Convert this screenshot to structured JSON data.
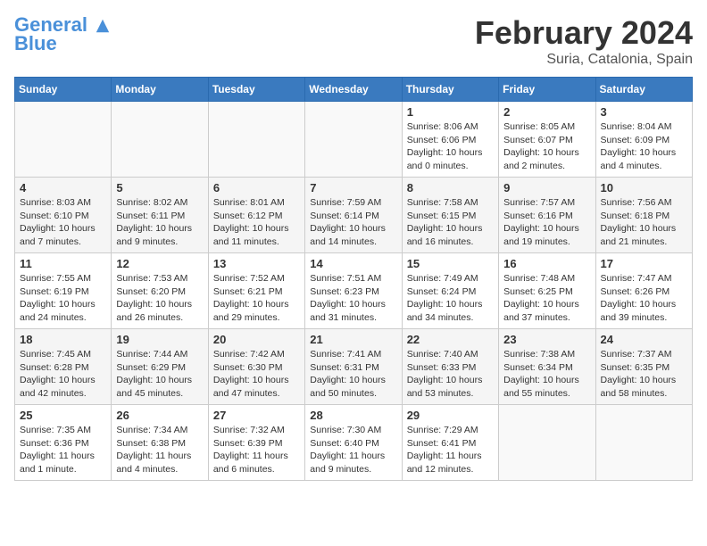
{
  "header": {
    "logo_line1": "General",
    "logo_line2": "Blue",
    "month": "February 2024",
    "location": "Suria, Catalonia, Spain"
  },
  "days_of_week": [
    "Sunday",
    "Monday",
    "Tuesday",
    "Wednesday",
    "Thursday",
    "Friday",
    "Saturday"
  ],
  "weeks": [
    [
      {
        "day": "",
        "info": ""
      },
      {
        "day": "",
        "info": ""
      },
      {
        "day": "",
        "info": ""
      },
      {
        "day": "",
        "info": ""
      },
      {
        "day": "1",
        "info": "Sunrise: 8:06 AM\nSunset: 6:06 PM\nDaylight: 10 hours\nand 0 minutes."
      },
      {
        "day": "2",
        "info": "Sunrise: 8:05 AM\nSunset: 6:07 PM\nDaylight: 10 hours\nand 2 minutes."
      },
      {
        "day": "3",
        "info": "Sunrise: 8:04 AM\nSunset: 6:09 PM\nDaylight: 10 hours\nand 4 minutes."
      }
    ],
    [
      {
        "day": "4",
        "info": "Sunrise: 8:03 AM\nSunset: 6:10 PM\nDaylight: 10 hours\nand 7 minutes."
      },
      {
        "day": "5",
        "info": "Sunrise: 8:02 AM\nSunset: 6:11 PM\nDaylight: 10 hours\nand 9 minutes."
      },
      {
        "day": "6",
        "info": "Sunrise: 8:01 AM\nSunset: 6:12 PM\nDaylight: 10 hours\nand 11 minutes."
      },
      {
        "day": "7",
        "info": "Sunrise: 7:59 AM\nSunset: 6:14 PM\nDaylight: 10 hours\nand 14 minutes."
      },
      {
        "day": "8",
        "info": "Sunrise: 7:58 AM\nSunset: 6:15 PM\nDaylight: 10 hours\nand 16 minutes."
      },
      {
        "day": "9",
        "info": "Sunrise: 7:57 AM\nSunset: 6:16 PM\nDaylight: 10 hours\nand 19 minutes."
      },
      {
        "day": "10",
        "info": "Sunrise: 7:56 AM\nSunset: 6:18 PM\nDaylight: 10 hours\nand 21 minutes."
      }
    ],
    [
      {
        "day": "11",
        "info": "Sunrise: 7:55 AM\nSunset: 6:19 PM\nDaylight: 10 hours\nand 24 minutes."
      },
      {
        "day": "12",
        "info": "Sunrise: 7:53 AM\nSunset: 6:20 PM\nDaylight: 10 hours\nand 26 minutes."
      },
      {
        "day": "13",
        "info": "Sunrise: 7:52 AM\nSunset: 6:21 PM\nDaylight: 10 hours\nand 29 minutes."
      },
      {
        "day": "14",
        "info": "Sunrise: 7:51 AM\nSunset: 6:23 PM\nDaylight: 10 hours\nand 31 minutes."
      },
      {
        "day": "15",
        "info": "Sunrise: 7:49 AM\nSunset: 6:24 PM\nDaylight: 10 hours\nand 34 minutes."
      },
      {
        "day": "16",
        "info": "Sunrise: 7:48 AM\nSunset: 6:25 PM\nDaylight: 10 hours\nand 37 minutes."
      },
      {
        "day": "17",
        "info": "Sunrise: 7:47 AM\nSunset: 6:26 PM\nDaylight: 10 hours\nand 39 minutes."
      }
    ],
    [
      {
        "day": "18",
        "info": "Sunrise: 7:45 AM\nSunset: 6:28 PM\nDaylight: 10 hours\nand 42 minutes."
      },
      {
        "day": "19",
        "info": "Sunrise: 7:44 AM\nSunset: 6:29 PM\nDaylight: 10 hours\nand 45 minutes."
      },
      {
        "day": "20",
        "info": "Sunrise: 7:42 AM\nSunset: 6:30 PM\nDaylight: 10 hours\nand 47 minutes."
      },
      {
        "day": "21",
        "info": "Sunrise: 7:41 AM\nSunset: 6:31 PM\nDaylight: 10 hours\nand 50 minutes."
      },
      {
        "day": "22",
        "info": "Sunrise: 7:40 AM\nSunset: 6:33 PM\nDaylight: 10 hours\nand 53 minutes."
      },
      {
        "day": "23",
        "info": "Sunrise: 7:38 AM\nSunset: 6:34 PM\nDaylight: 10 hours\nand 55 minutes."
      },
      {
        "day": "24",
        "info": "Sunrise: 7:37 AM\nSunset: 6:35 PM\nDaylight: 10 hours\nand 58 minutes."
      }
    ],
    [
      {
        "day": "25",
        "info": "Sunrise: 7:35 AM\nSunset: 6:36 PM\nDaylight: 11 hours\nand 1 minute."
      },
      {
        "day": "26",
        "info": "Sunrise: 7:34 AM\nSunset: 6:38 PM\nDaylight: 11 hours\nand 4 minutes."
      },
      {
        "day": "27",
        "info": "Sunrise: 7:32 AM\nSunset: 6:39 PM\nDaylight: 11 hours\nand 6 minutes."
      },
      {
        "day": "28",
        "info": "Sunrise: 7:30 AM\nSunset: 6:40 PM\nDaylight: 11 hours\nand 9 minutes."
      },
      {
        "day": "29",
        "info": "Sunrise: 7:29 AM\nSunset: 6:41 PM\nDaylight: 11 hours\nand 12 minutes."
      },
      {
        "day": "",
        "info": ""
      },
      {
        "day": "",
        "info": ""
      }
    ]
  ]
}
